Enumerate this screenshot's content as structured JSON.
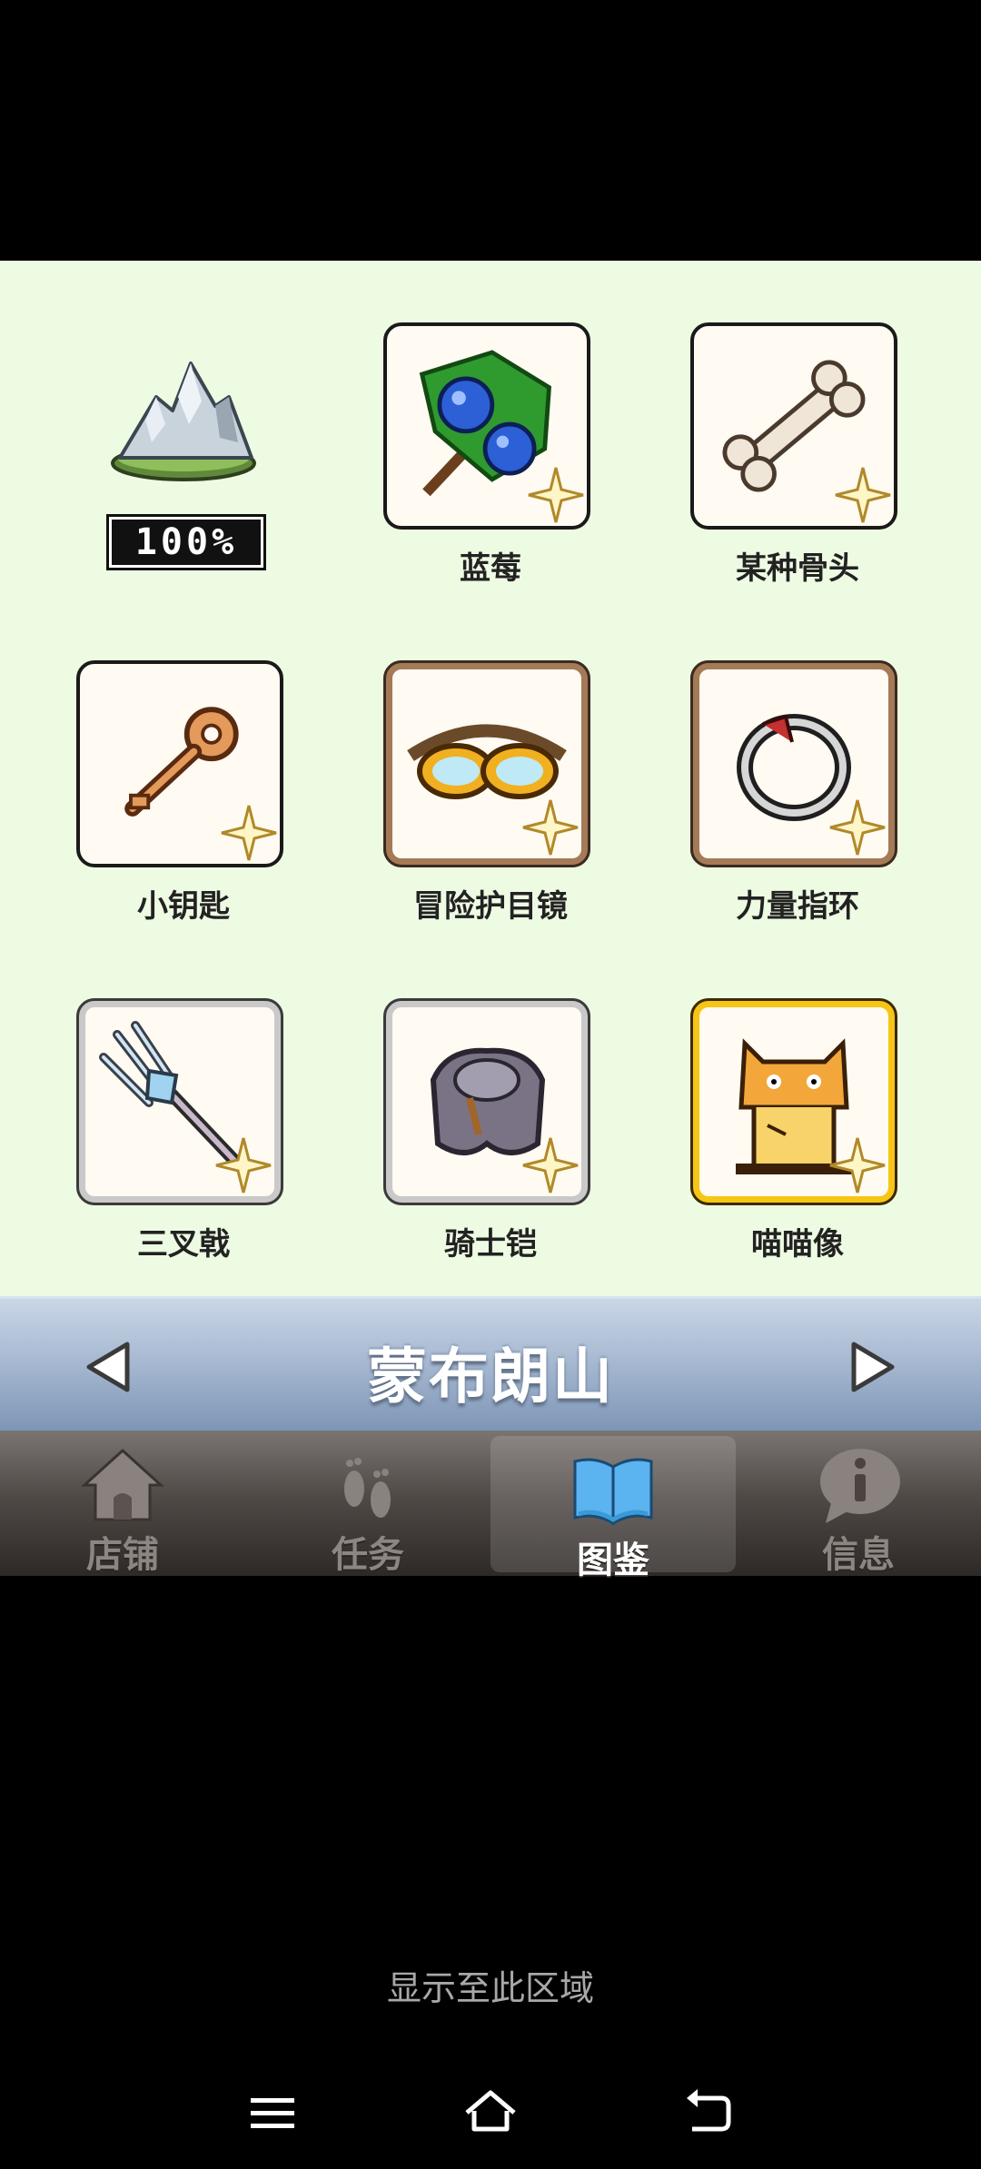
{
  "collection": {
    "progress_badge": "100%",
    "items": [
      {
        "name": "蓝莓"
      },
      {
        "name": "某种骨头"
      },
      {
        "name": "小钥匙"
      },
      {
        "name": "冒险护目镜"
      },
      {
        "name": "力量指环"
      },
      {
        "name": "三叉戟"
      },
      {
        "name": "骑士铠"
      },
      {
        "name": "喵喵像"
      }
    ]
  },
  "region": {
    "title": "蒙布朗山",
    "prev_icon": "left-triangle-icon",
    "next_icon": "right-triangle-icon"
  },
  "nav": {
    "tabs": [
      {
        "label": "店铺",
        "icon": "shop-house-icon"
      },
      {
        "label": "任务",
        "icon": "footprints-icon"
      },
      {
        "label": "图鉴",
        "icon": "open-book-icon",
        "active": true
      },
      {
        "label": "信息",
        "icon": "info-bubble-icon"
      }
    ]
  },
  "footer": {
    "hint": "显示至此区域"
  },
  "system_nav": {
    "menu_icon": "menu-icon",
    "home_icon": "home-icon",
    "back_icon": "back-icon"
  },
  "colors": {
    "content_bg": "#eefbe3",
    "gold_frame": "#f6c515",
    "bronze_frame": "#a57a57",
    "silver_frame": "#c9c9c9"
  }
}
